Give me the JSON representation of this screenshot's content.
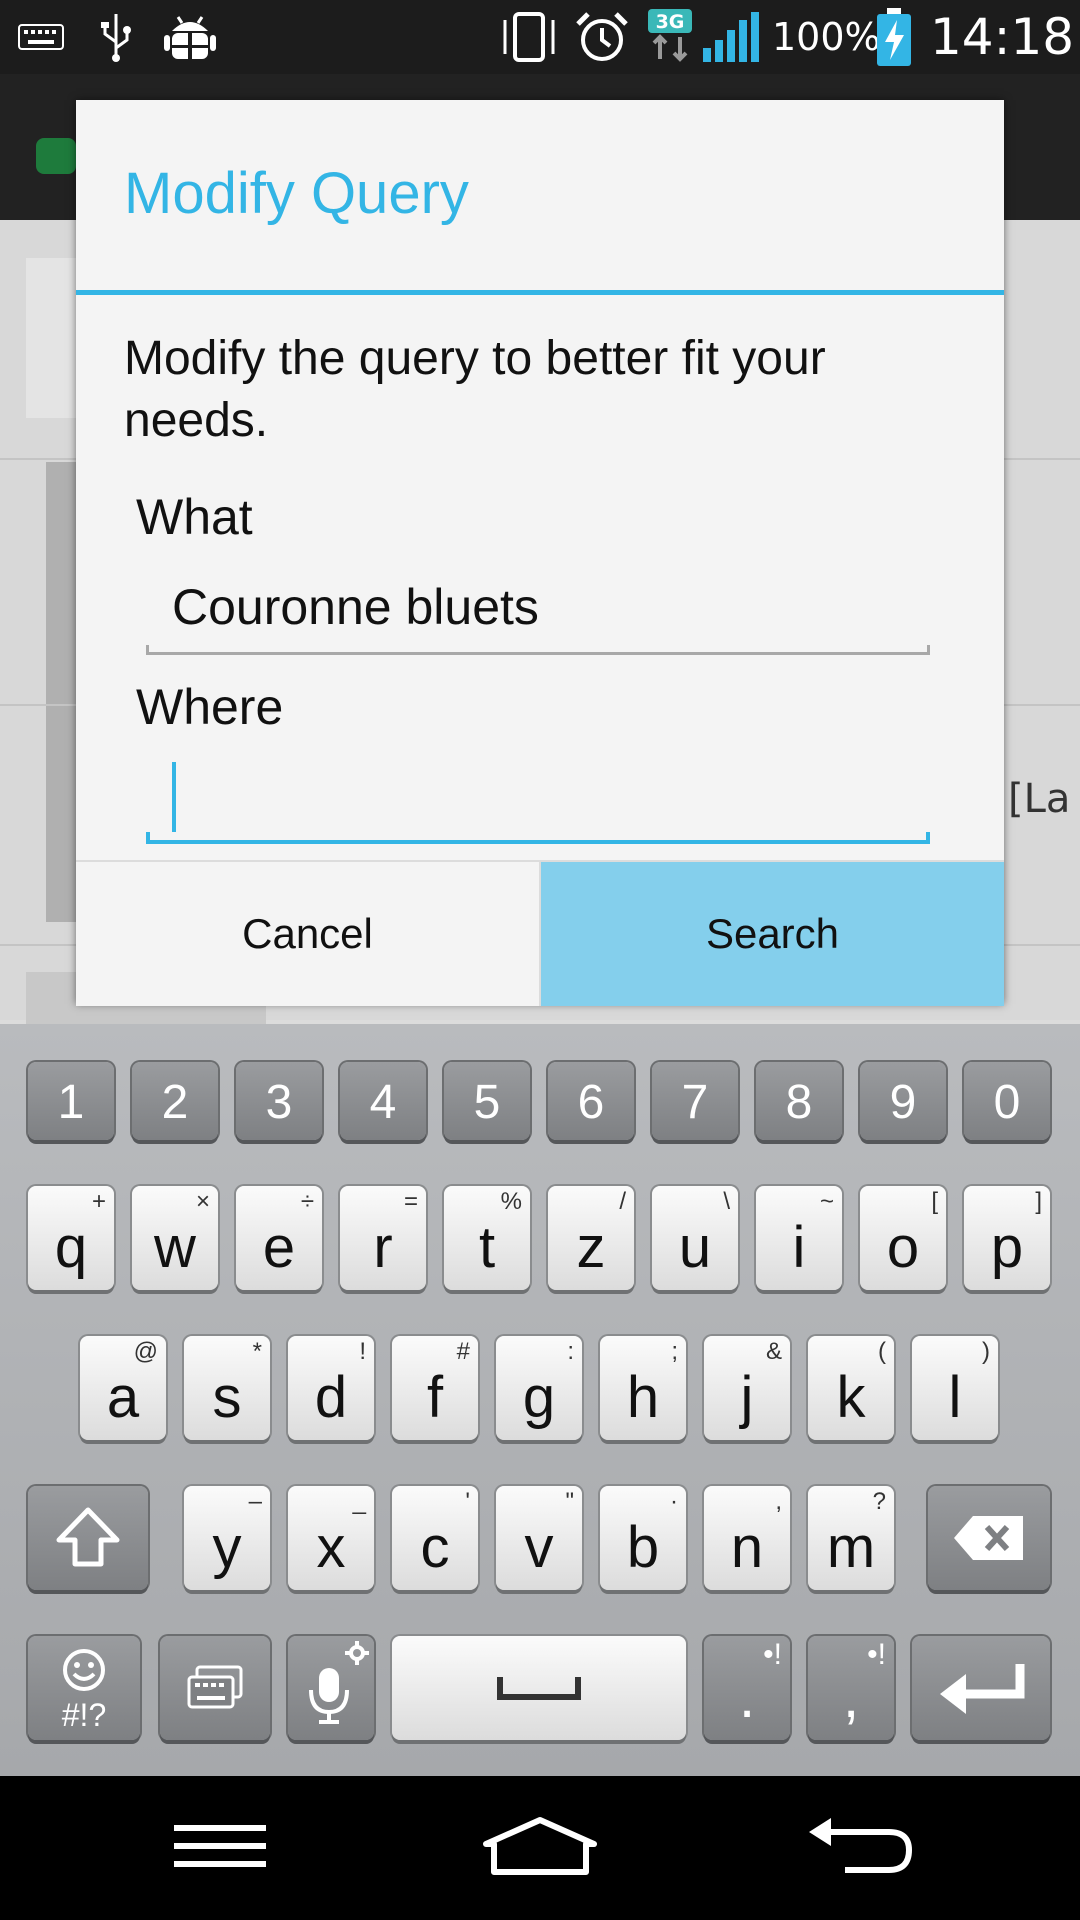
{
  "status_bar": {
    "network_type": "3G",
    "battery": "100%",
    "time": "14:18",
    "icons": [
      "keyboard-icon",
      "usb-icon",
      "android-debug-icon",
      "vibrate-icon",
      "alarm-icon",
      "data-arrows-icon",
      "signal-icon",
      "battery-charging-icon"
    ]
  },
  "background": {
    "peek_text": "[La"
  },
  "dialog": {
    "title": "Modify Query",
    "message": "Modify the query to better fit your needs.",
    "what_label": "What",
    "what_value": "Couronne bluets",
    "where_label": "Where",
    "where_value": "",
    "cancel_label": "Cancel",
    "search_label": "Search",
    "accent_color": "#33b5e5"
  },
  "keyboard": {
    "number_row": [
      "1",
      "2",
      "3",
      "4",
      "5",
      "6",
      "7",
      "8",
      "9",
      "0"
    ],
    "row1": [
      {
        "key": "q",
        "alt": "+"
      },
      {
        "key": "w",
        "alt": "×"
      },
      {
        "key": "e",
        "alt": "÷"
      },
      {
        "key": "r",
        "alt": "="
      },
      {
        "key": "t",
        "alt": "%"
      },
      {
        "key": "z",
        "alt": "/"
      },
      {
        "key": "u",
        "alt": "\\"
      },
      {
        "key": "i",
        "alt": "~"
      },
      {
        "key": "o",
        "alt": "["
      },
      {
        "key": "p",
        "alt": "]"
      }
    ],
    "row2": [
      {
        "key": "a",
        "alt": "@"
      },
      {
        "key": "s",
        "alt": "*"
      },
      {
        "key": "d",
        "alt": "!"
      },
      {
        "key": "f",
        "alt": "#"
      },
      {
        "key": "g",
        "alt": ":"
      },
      {
        "key": "h",
        "alt": ";"
      },
      {
        "key": "j",
        "alt": "&"
      },
      {
        "key": "k",
        "alt": "("
      },
      {
        "key": "l",
        "alt": ")"
      }
    ],
    "row3": [
      {
        "key": "y",
        "alt": "–"
      },
      {
        "key": "x",
        "alt": "_"
      },
      {
        "key": "c",
        "alt": "'"
      },
      {
        "key": "v",
        "alt": "\""
      },
      {
        "key": "b",
        "alt": "·"
      },
      {
        "key": "n",
        "alt": ","
      },
      {
        "key": "m",
        "alt": "?"
      }
    ],
    "symbols_label": "#!?",
    "period_key": ".",
    "comma_key": ",",
    "punct_alt": "•!",
    "icons": [
      "shift-icon",
      "backspace-icon",
      "emoji-icon",
      "keyboard-switch-icon",
      "microphone-icon",
      "settings-icon",
      "space-icon",
      "enter-icon"
    ]
  },
  "nav_bar": {
    "icons": [
      "menu-icon",
      "home-icon",
      "back-icon"
    ]
  }
}
